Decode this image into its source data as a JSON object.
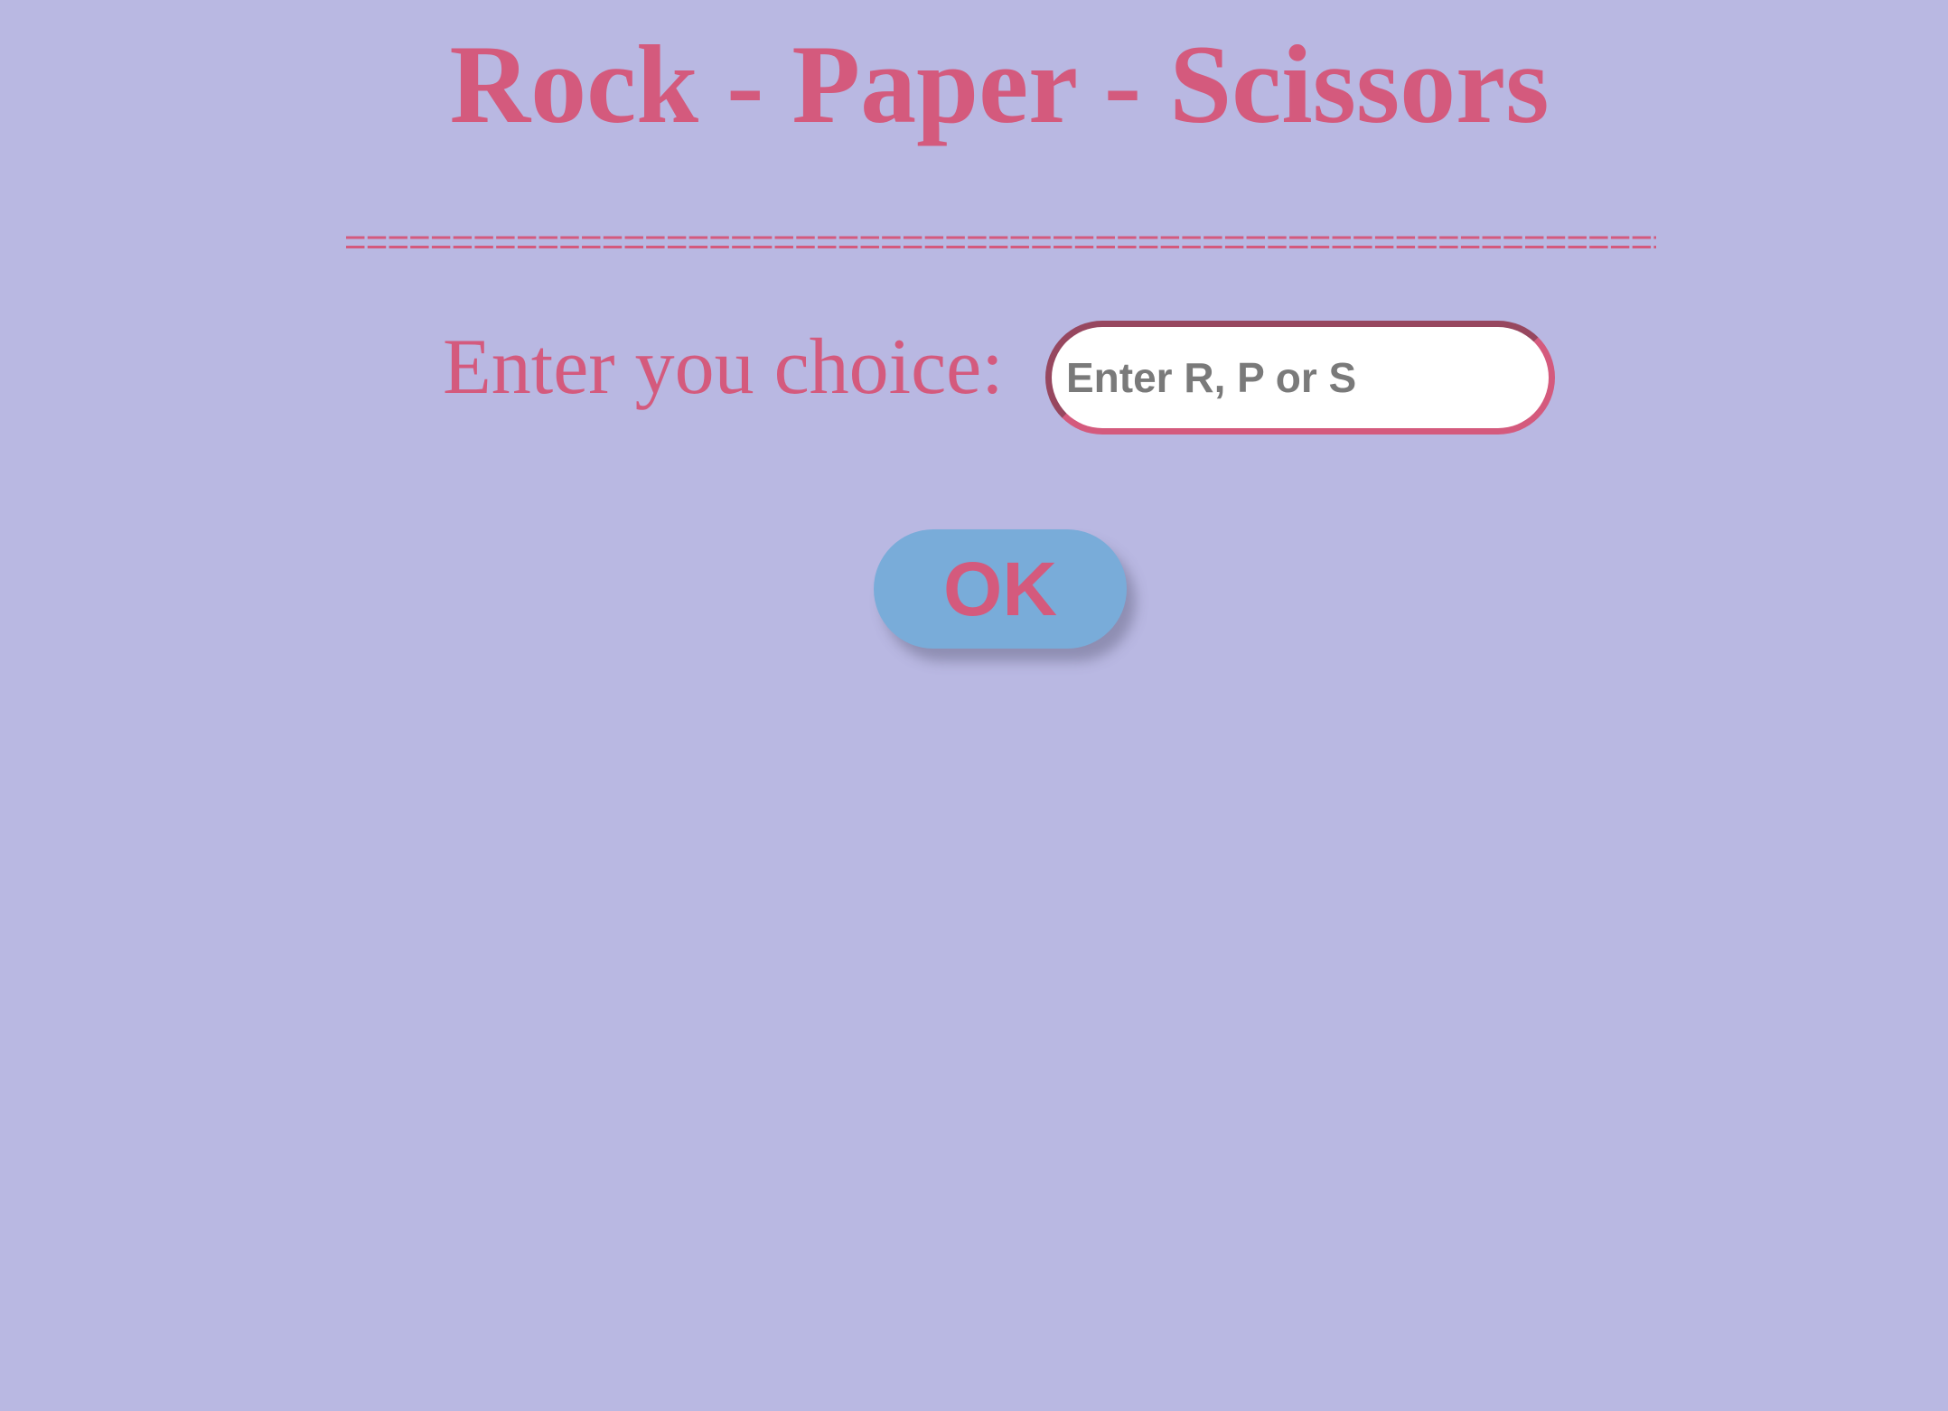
{
  "page": {
    "title": "Rock - Paper - Scissors",
    "divider": "===================================================================================================="
  },
  "form": {
    "choice_label": "Enter you choice:",
    "choice_input": {
      "value": "",
      "placeholder": "Enter R, P or S"
    },
    "ok_label": "OK"
  },
  "colors": {
    "background": "#b9b8e2",
    "accent_text": "#d45a7d",
    "button_background": "#79acd9",
    "input_background": "#ffffff",
    "placeholder_text": "#7a7a7a"
  }
}
